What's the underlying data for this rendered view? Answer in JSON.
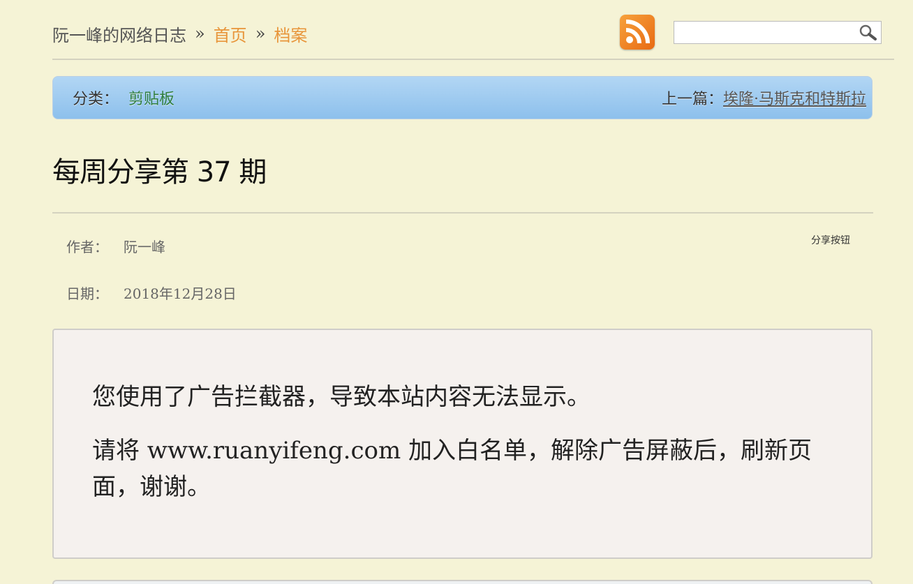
{
  "header": {
    "site_name": "阮一峰的网络日志",
    "separator": "»",
    "home_link": "首页",
    "archive_link": "档案"
  },
  "icons": {
    "rss": "rss-feed-icon",
    "search": "magnifier-search-icon"
  },
  "search": {
    "value": "",
    "placeholder": ""
  },
  "category_bar": {
    "category_label": "分类：",
    "category_value": "剪贴板",
    "prev_label": "上一篇：",
    "prev_title": "埃隆·马斯克和特斯拉"
  },
  "post": {
    "title": "每周分享第 37 期",
    "author_label": "作者：",
    "author": "阮一峰",
    "date_label": "日期：",
    "date": "2018年12月28日",
    "share_label": "分享按钮"
  },
  "notice": {
    "line1": "您使用了广告拦截器，导致本站内容无法显示。",
    "line2": "请将 www.ruanyifeng.com 加入白名单，解除广告屏蔽后，刷新页面，谢谢。"
  },
  "colors": {
    "background": "#f5f3d6",
    "link_orange": "#e8953a",
    "category_green": "#2e7d3f",
    "bar_blue": "#9fcbf0"
  }
}
